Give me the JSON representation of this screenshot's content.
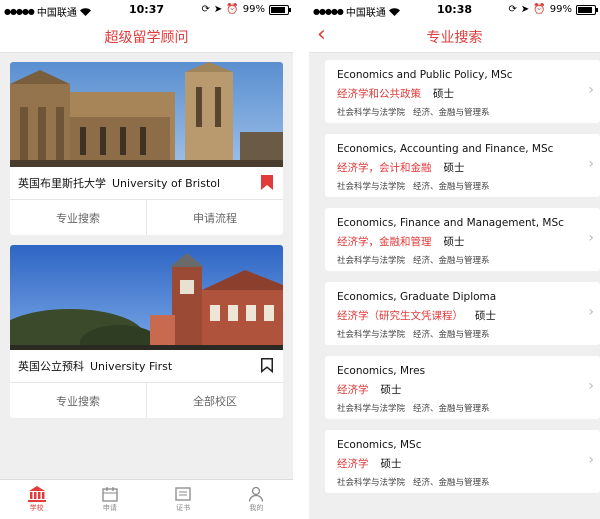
{
  "left": {
    "status": {
      "carrier": "中国联通",
      "time": "10:37",
      "battery": "99%"
    },
    "nav_title": "超级留学顾问",
    "cards": [
      {
        "name_cn": "英国布里斯托大学",
        "name_en": "University of Bristol",
        "bookmarked": true,
        "actions": [
          "专业搜索",
          "申请流程"
        ]
      },
      {
        "name_cn": "英国公立预科",
        "name_en": "University First",
        "bookmarked": false,
        "actions": [
          "专业搜索",
          "全部校区"
        ]
      }
    ],
    "tabs": [
      {
        "label": "学校",
        "active": true
      },
      {
        "label": "申请",
        "active": false
      },
      {
        "label": "证书",
        "active": false
      },
      {
        "label": "我的",
        "active": false
      }
    ]
  },
  "right": {
    "status": {
      "carrier": "中国联通",
      "time": "10:38",
      "battery": "99%"
    },
    "nav_title": "专业搜索",
    "programs": [
      {
        "name": "Economics and Public Policy, MSc",
        "field": "经济学和公共政策",
        "degree": "硕士",
        "faculty": "社会科学与法学院",
        "department": "经济、金融与管理系"
      },
      {
        "name": "Economics, Accounting and Finance, MSc",
        "field": "经济学，会计和金融",
        "degree": "硕士",
        "faculty": "社会科学与法学院",
        "department": "经济、金融与管理系"
      },
      {
        "name": "Economics, Finance and Management, MSc",
        "field": "经济学，金融和管理",
        "degree": "硕士",
        "faculty": "社会科学与法学院",
        "department": "经济、金融与管理系"
      },
      {
        "name": "Economics, Graduate Diploma",
        "field": "经济学（研究生文凭课程）",
        "degree": "硕士",
        "faculty": "社会科学与法学院",
        "department": "经济、金融与管理系"
      },
      {
        "name": "Economics, Mres",
        "field": "经济学",
        "degree": "硕士",
        "faculty": "社会科学与法学院",
        "department": "经济、金融与管理系"
      },
      {
        "name": "Economics, MSc",
        "field": "经济学",
        "degree": "硕士",
        "faculty": "社会科学与法学院",
        "department": "经济、金融与管理系"
      }
    ]
  },
  "colors": {
    "accent": "#e23b3b",
    "background": "#efefef"
  }
}
